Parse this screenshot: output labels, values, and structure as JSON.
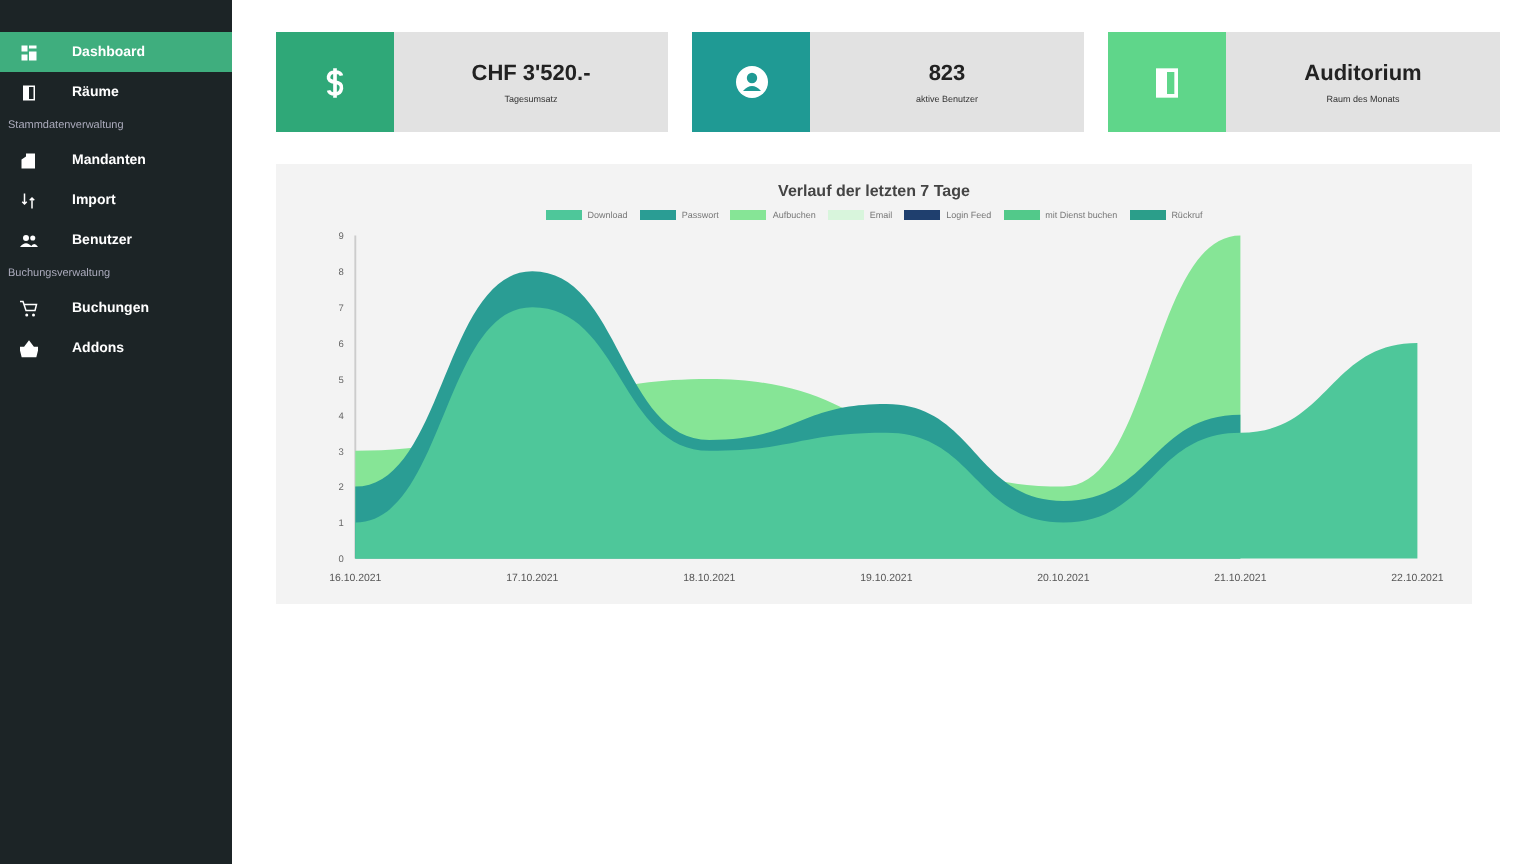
{
  "sidebar": {
    "items": [
      {
        "kind": "link",
        "label": "Dashboard",
        "selected": true
      },
      {
        "kind": "link",
        "label": "Räume",
        "selected": false
      },
      {
        "kind": "heading",
        "label": "Stammdatenverwaltung"
      },
      {
        "kind": "link",
        "label": "Mandanten",
        "selected": false
      },
      {
        "kind": "link",
        "label": "Import",
        "selected": false
      },
      {
        "kind": "link",
        "label": "Benutzer",
        "selected": false
      },
      {
        "kind": "heading",
        "label": "Buchungsverwaltung"
      },
      {
        "kind": "link",
        "label": "Buchungen",
        "selected": false
      },
      {
        "kind": "link",
        "label": "Addons",
        "selected": false
      }
    ]
  },
  "cards": [
    {
      "color": "#2fa878",
      "value": "CHF 3'520.-",
      "caption": "Tagesumsatz"
    },
    {
      "color": "#1f9a94",
      "value": "823",
      "caption": "aktive Benutzer"
    },
    {
      "color": "#5fd68a",
      "value": "Auditorium",
      "caption": "Raum des Monats"
    }
  ],
  "chart": {
    "chart_data": {
      "type": "area",
      "title": "Verlauf der letzten 7 Tage",
      "categories": [
        "16.10.2021",
        "17.10.2021",
        "18.10.2021",
        "19.10.2021",
        "20.10.2021",
        "21.10.2021",
        "22.10.2021"
      ],
      "ylim": [
        0,
        9
      ],
      "yticks": [
        0,
        1,
        2,
        3,
        4,
        5,
        6,
        7,
        8,
        9
      ],
      "series": [
        {
          "name": "Download",
          "color": "#4ec79a",
          "values": [
            1,
            7,
            3,
            3.5,
            1,
            3.5,
            6
          ]
        },
        {
          "name": "Passwort",
          "color": "#2a9d94",
          "values": [
            2,
            8,
            3.3,
            4.3,
            1.6,
            4,
            null
          ]
        },
        {
          "name": "Aufbuchen",
          "color": "#86e596",
          "values": [
            3,
            null,
            5,
            null,
            2,
            9,
            null
          ]
        },
        {
          "name": "Email",
          "color": "#d8f5dc",
          "values": [
            null,
            null,
            null,
            null,
            null,
            null,
            null
          ]
        },
        {
          "name": "Login Feed",
          "color": "#1f3f6e",
          "values": [
            null,
            null,
            null,
            null,
            null,
            null,
            null
          ]
        },
        {
          "name": "mit Dienst buchen",
          "color": "#52c98a",
          "values": [
            null,
            null,
            null,
            null,
            null,
            null,
            null
          ]
        },
        {
          "name": "Rückruf",
          "color": "#2b9e8a",
          "values": [
            null,
            null,
            null,
            null,
            null,
            null,
            null
          ]
        }
      ]
    }
  }
}
